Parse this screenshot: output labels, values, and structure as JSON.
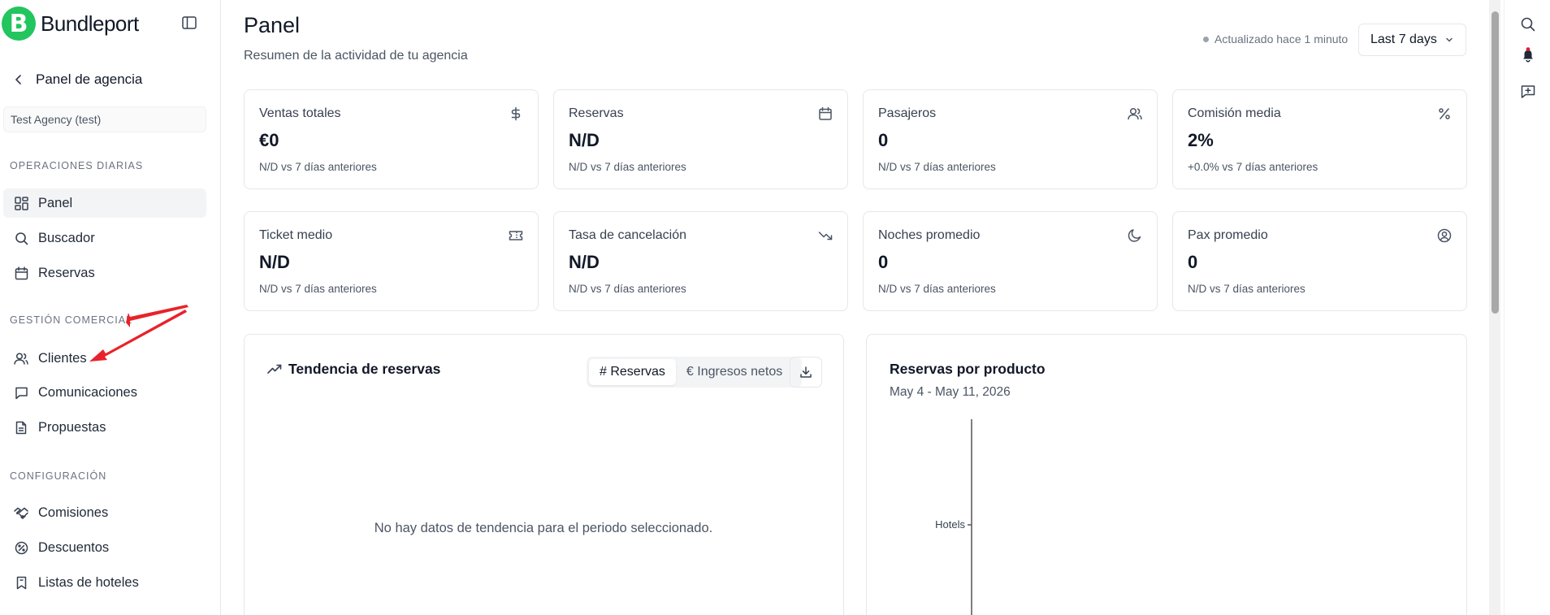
{
  "brand": {
    "logo_letter": "B",
    "name": "Bundleport",
    "color": "#22c55e"
  },
  "sidebar": {
    "back_label": "Panel de agencia",
    "agency": "Test Agency (test)",
    "sections": [
      {
        "title": "OPERACIONES DIARIAS",
        "items": [
          {
            "label": "Panel",
            "icon": "grid-icon",
            "active": true
          },
          {
            "label": "Buscador",
            "icon": "search-icon"
          },
          {
            "label": "Reservas",
            "icon": "calendar-icon"
          }
        ]
      },
      {
        "title": "GESTIÓN COMERCIAL",
        "items": [
          {
            "label": "Clientes",
            "icon": "users-icon"
          },
          {
            "label": "Comunicaciones",
            "icon": "message-icon"
          },
          {
            "label": "Propuestas",
            "icon": "document-icon"
          }
        ]
      },
      {
        "title": "CONFIGURACIÓN",
        "items": [
          {
            "label": "Comisiones",
            "icon": "handshake-icon"
          },
          {
            "label": "Descuentos",
            "icon": "badge-percent-icon"
          },
          {
            "label": "Listas de hoteles",
            "icon": "bookmark-icon"
          }
        ]
      }
    ]
  },
  "header": {
    "title": "Panel",
    "subtitle": "Resumen de la actividad de tu agencia",
    "updated": "Actualizado hace 1 minuto",
    "range": "Last 7 days"
  },
  "metrics": [
    {
      "label": "Ventas totales",
      "value": "€0",
      "delta": "N/D vs 7 días anteriores",
      "icon": "dollar-icon"
    },
    {
      "label": "Reservas",
      "value": "N/D",
      "delta": "N/D vs 7 días anteriores",
      "icon": "calendar-icon"
    },
    {
      "label": "Pasajeros",
      "value": "0",
      "delta": "N/D vs 7 días anteriores",
      "icon": "users-icon"
    },
    {
      "label": "Comisión media",
      "value": "2%",
      "delta": "+0.0% vs 7 días anteriores",
      "icon": "percent-icon"
    },
    {
      "label": "Ticket medio",
      "value": "N/D",
      "delta": "N/D vs 7 días anteriores",
      "icon": "ticket-icon"
    },
    {
      "label": "Tasa de cancelación",
      "value": "N/D",
      "delta": "N/D vs 7 días anteriores",
      "icon": "trending-down-icon"
    },
    {
      "label": "Noches promedio",
      "value": "0",
      "delta": "N/D vs 7 días anteriores",
      "icon": "moon-icon"
    },
    {
      "label": "Pax promedio",
      "value": "0",
      "delta": "N/D vs 7 días anteriores",
      "icon": "user-circle-icon"
    }
  ],
  "trend": {
    "title": "Tendencia de reservas",
    "tabs": [
      "# Reservas",
      "€ Ingresos netos"
    ],
    "empty": "No hay datos de tendencia para el periodo seleccionado."
  },
  "product": {
    "title": "Reservas por producto",
    "range": "May 4 - May 11, 2026",
    "categories": [
      "Hotels"
    ]
  },
  "accent": {
    "alert": "#e11d2e",
    "annotation": "#e8222a"
  }
}
